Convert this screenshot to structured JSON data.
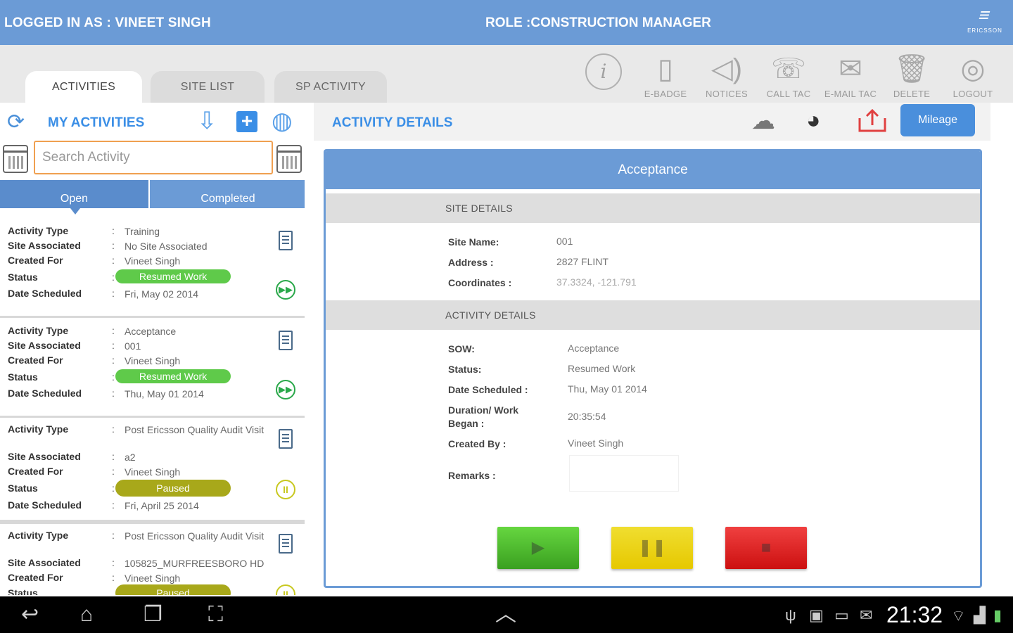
{
  "header": {
    "logged_in": "LOGGED IN AS : VINEET SINGH",
    "role": "ROLE :CONSTRUCTION MANAGER",
    "logo_word": "ERICSSON"
  },
  "tabs": [
    {
      "label": "ACTIVITIES",
      "active": true
    },
    {
      "label": "SITE LIST",
      "active": false
    },
    {
      "label": "SP ACTIVITY",
      "active": false
    }
  ],
  "toolbar": {
    "info": "i",
    "items": [
      {
        "label": "E-BADGE",
        "icon": "e-badge-icon"
      },
      {
        "label": "NOTICES",
        "icon": "speaker-icon"
      },
      {
        "label": "CALL TAC",
        "icon": "phone-icon"
      },
      {
        "label": "E-MAIL TAC",
        "icon": "mail-icon"
      },
      {
        "label": "DELETE",
        "icon": "trash-icon"
      },
      {
        "label": "LOGOUT",
        "icon": "fingerprint-icon"
      }
    ]
  },
  "left": {
    "title": "MY ACTIVITIES",
    "search_placeholder": "Search Activity",
    "segments": {
      "open": "Open",
      "completed": "Completed"
    },
    "field_labels": {
      "type": "Activity Type",
      "site": "Site Associated",
      "created": "Created For",
      "status": "Status",
      "date": "Date Scheduled"
    },
    "cards": [
      {
        "type": "Training",
        "site": "No Site Associated",
        "created": "Vineet Singh",
        "status": "Resumed Work",
        "date": "Fri, May 02 2014"
      },
      {
        "type": "Acceptance",
        "site": "001",
        "created": "Vineet Singh",
        "status": "Resumed Work",
        "date": "Thu, May 01 2014"
      },
      {
        "type": "Post Ericsson Quality Audit Visit",
        "site": "a2",
        "created": "Vineet Singh",
        "status": "Paused",
        "date": "Fri, April 25 2014"
      },
      {
        "type": "Post Ericsson Quality Audit Visit",
        "site": "105825_MURFREESBORO HD",
        "created": "Vineet Singh",
        "status": "Paused",
        "date": ""
      }
    ]
  },
  "right": {
    "title": "ACTIVITY DETAILS",
    "mileage": "Mileage",
    "panel_title": "Acceptance",
    "site_section": "SITE DETAILS",
    "activity_section": "ACTIVITY DETAILS",
    "site": {
      "name_label": "Site Name:",
      "name": "001",
      "address_label": "Address :",
      "address": "2827 FLINT",
      "coords_label": "Coordinates :",
      "coords": "37.3324, -121.791"
    },
    "activity": {
      "sow_label": "SOW:",
      "sow": "Acceptance",
      "status_label": "Status:",
      "status": "Resumed Work",
      "date_label": "Date Scheduled :",
      "date": "Thu, May 01 2014",
      "duration_label_1": "Duration/ Work",
      "duration_label_2": "Began :",
      "duration": "20:35:54",
      "created_label": "Created By :",
      "created": "Vineet Singh",
      "remarks_label": "Remarks :"
    }
  },
  "statusbar": {
    "time": "21:32"
  },
  "colors": {
    "brand_blue": "#6b9bd6",
    "accent_blue": "#3a8ee6",
    "status_green": "#5fca4a",
    "status_olive": "#a8a81a",
    "search_border": "#f0a050"
  }
}
